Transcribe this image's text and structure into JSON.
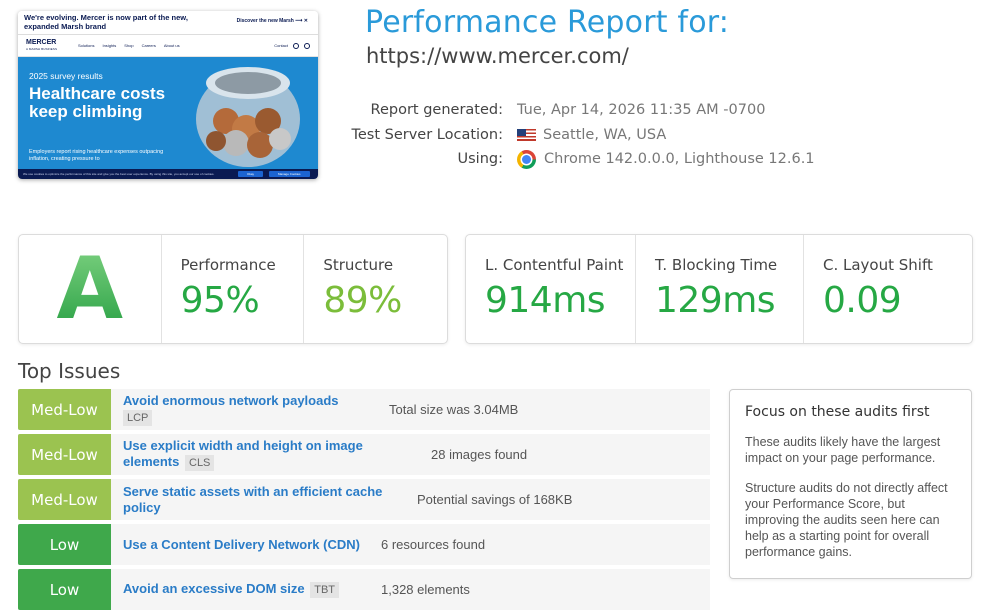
{
  "thumbnail": {
    "banner_text": "We're evolving. Mercer is now part of the new, expanded Marsh brand",
    "banner_link": "Discover the new Marsh ⟶ ✕",
    "logo": "MERCER",
    "logo_sub": "A MARSH BUSINESS",
    "nav_links": [
      "Solutions",
      "Insights",
      "Shop",
      "Careers",
      "About us"
    ],
    "nav_right": "Contact",
    "hero_small": "2025 survey results",
    "hero_title": "Healthcare costs keep climbing",
    "hero_sub": "Employers report rising healthcare expenses outpacing inflation, creating pressure to",
    "cookie_text": "We use cookies to optimize the performance of this site and give you the best user experience. By using this site, you accept our use of cookies.",
    "cookie_btn1": "Okay",
    "cookie_btn2": "Manage Cookies"
  },
  "header": {
    "title": "Performance Report for:",
    "url": "https://www.mercer.com/"
  },
  "meta": {
    "generated_label": "Report generated:",
    "generated_value": "Tue, Apr 14, 2026 11:35 AM -0700",
    "location_label": "Test Server Location:",
    "location_value": "Seattle, WA, USA",
    "using_label": "Using:",
    "using_value": "Chrome 142.0.0.0, Lighthouse 12.6.1"
  },
  "scores": {
    "grade": "A",
    "performance_label": "Performance",
    "performance_value": "95%",
    "structure_label": "Structure",
    "structure_value": "89%"
  },
  "web_vitals": {
    "lcp_label": "L. Contentful Paint",
    "lcp_value": "914ms",
    "tbt_label": "T. Blocking Time",
    "tbt_value": "129ms",
    "cls_label": "C. Layout Shift",
    "cls_value": "0.09"
  },
  "top_issues": {
    "title": "Top Issues",
    "items": [
      {
        "severity": "Med-Low",
        "name": "Avoid enormous network payloads",
        "tag": "LCP",
        "detail": "Total size was 3.04MB"
      },
      {
        "severity": "Med-Low",
        "name": "Use explicit width and height on image elements",
        "tag": "CLS",
        "detail": "28 images found"
      },
      {
        "severity": "Med-Low",
        "name": "Serve static assets with an efficient cache policy",
        "tag": "",
        "detail": "Potential savings of 168KB"
      },
      {
        "severity": "Low",
        "name": "Use a Content Delivery Network (CDN)",
        "tag": "",
        "detail": "6 resources found"
      },
      {
        "severity": "Low",
        "name": "Avoid an excessive DOM size",
        "tag": "TBT",
        "detail": "1,328 elements"
      }
    ]
  },
  "focus": {
    "title": "Focus on these audits first",
    "p1": "These audits likely have the largest impact on your page performance.",
    "p2": "Structure audits do not directly affect your Performance Score, but improving the audits seen here can help as a starting point for overall performance gains."
  },
  "colors": {
    "title_blue": "#2a9ad9",
    "grade_green": "#2fb34a",
    "value_green": "#26a844",
    "structure_green": "#7bbd3a",
    "sev_medlow": "#9bc350",
    "sev_low": "#3fa84b",
    "link_blue": "#2a7cc7"
  }
}
